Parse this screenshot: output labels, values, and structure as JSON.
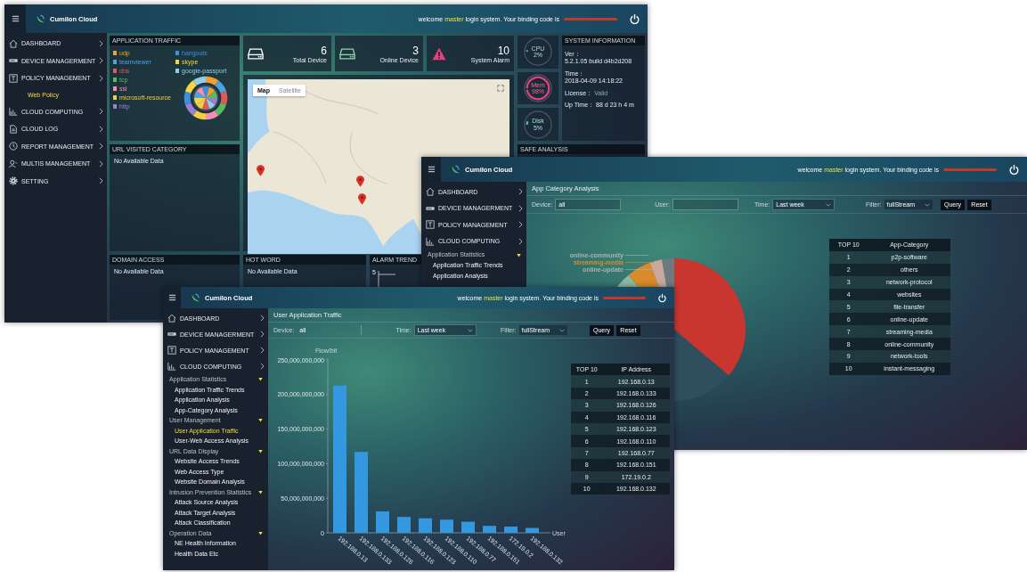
{
  "dashboard_window": {
    "header": {
      "brand": "Cumilon Cloud",
      "greeting": "welcome",
      "user": "master",
      "message": "login system.  Your binding code is"
    },
    "sidebar": {
      "items": [
        {
          "label": "DASHBOARD"
        },
        {
          "label": "DEVICE MANAGERMENT"
        },
        {
          "label": "POLICY MANAGEMENT",
          "children": [
            {
              "label": "Web Policy",
              "selected": true
            }
          ]
        },
        {
          "label": "CLOUD COMPUTING"
        },
        {
          "label": "CLOUD LOG"
        },
        {
          "label": "REPORT MANAGEMENT"
        },
        {
          "label": "MULTIS MANAGEMENT"
        },
        {
          "label": "SETTING"
        }
      ]
    },
    "application_traffic": {
      "title": "APPLICATION TRAFFIC",
      "legend": [
        {
          "label": "udp",
          "color": "#f0a030"
        },
        {
          "label": "teamviewer",
          "color": "#4aa3df"
        },
        {
          "label": "dns",
          "color": "#e05a5a"
        },
        {
          "label": "tcp",
          "color": "#5cb85c"
        },
        {
          "label": "ssl",
          "color": "#f48fb1"
        },
        {
          "label": "microsoft-resource",
          "color": "#f0d040"
        },
        {
          "label": "http",
          "color": "#9b7fd4"
        },
        {
          "label": "hangouts",
          "color": "#3d8fe0"
        },
        {
          "label": "skype",
          "color": "#f5d742"
        },
        {
          "label": "google-passport",
          "color": "#8ecfe8"
        }
      ]
    },
    "stats": [
      {
        "value": "6",
        "label": "Total Device"
      },
      {
        "value": "3",
        "label": "Online Device"
      },
      {
        "value": "10",
        "label": "System Alarm"
      }
    ],
    "gauges": [
      {
        "label": "CPU",
        "value": "2%",
        "level": 0.02
      },
      {
        "label": "Mem",
        "value": "98%",
        "level": 0.98
      },
      {
        "label": "Disk",
        "value": "5%",
        "level": 0.05
      }
    ],
    "system_information": {
      "title": "SYSTEM INFORMATION",
      "rows": [
        {
          "label": "Ver：",
          "value": "5.2.1.05 build d4b2d208"
        },
        {
          "label": "Time：",
          "value": "2018-04-09 14:18:22"
        },
        {
          "label": "License：",
          "value": "Valid"
        },
        {
          "label": "Up Time：",
          "value": "88 d 23 h 4 m"
        }
      ]
    },
    "map": {
      "tabs": [
        {
          "label": "Map",
          "selected": true
        },
        {
          "label": "Satellite",
          "selected": false
        }
      ]
    },
    "url_visited_category": {
      "title": "URL VISITED CATEGORY",
      "message": "No Available Data"
    },
    "safe_analysis": {
      "title": "SAFE ANALYSIS"
    },
    "domain_access": {
      "title": "DOMAIN ACCESS",
      "message": "No Available Data"
    },
    "hot_word": {
      "title": "HOT WORD",
      "message": "No Available Data"
    },
    "alarm_trend": {
      "title": "ALARM TREND",
      "tick": "5"
    }
  },
  "category_window": {
    "header": {
      "brand": "Cumilon Cloud",
      "greeting": "welcome",
      "user": "master",
      "message": "login system.  Your binding code is"
    },
    "sidebar": {
      "items": [
        {
          "label": "DASHBOARD"
        },
        {
          "label": "DEVICE MANAGERMENT"
        },
        {
          "label": "POLICY MANAGEMENT"
        },
        {
          "label": "CLOUD COMPUTING",
          "children": [
            {
              "label": "Application Statistics",
              "expanded": true,
              "children": [
                {
                  "label": "Application Traffic Trends",
                  "selected": false
                },
                {
                  "label": "Application Analysis",
                  "selected": false
                }
              ]
            }
          ]
        }
      ]
    },
    "page_title": "App Category Analysis",
    "filters": [
      {
        "label": "Device:",
        "value": "all",
        "kind": "text"
      },
      {
        "label": "User:",
        "kind": "text"
      },
      {
        "label": "Time:",
        "value": "Last week",
        "kind": "select"
      },
      {
        "label": "Filter:",
        "value": "fullStream",
        "kind": "select"
      }
    ],
    "buttons": [
      "Query",
      "Reset"
    ],
    "slice_labels": [
      {
        "label": "online-community",
        "color": "#a9b3b0"
      },
      {
        "label": "streaming-media",
        "color": "#d98a2a"
      },
      {
        "label": "online-update",
        "color": "#a9b3b0"
      }
    ],
    "table": {
      "columns": [
        "TOP 10",
        "App-Category"
      ],
      "rows": [
        [
          "1",
          "p2p-software"
        ],
        [
          "2",
          "others"
        ],
        [
          "3",
          "network-protocol"
        ],
        [
          "4",
          "websites"
        ],
        [
          "5",
          "file-transfer"
        ],
        [
          "6",
          "online-update"
        ],
        [
          "7",
          "streaming-media"
        ],
        [
          "8",
          "online-community"
        ],
        [
          "9",
          "network-tools"
        ],
        [
          "10",
          "instant-messaging"
        ]
      ]
    }
  },
  "traffic_window": {
    "header": {
      "brand": "Cumilon Cloud",
      "greeting": "welcome",
      "user": "master",
      "message": "login system.  Your binding code is"
    },
    "sidebar": {
      "items": [
        {
          "label": "DASHBOARD"
        },
        {
          "label": "DEVICE MANAGERMENT"
        },
        {
          "label": "POLICY MANAGEMENT"
        },
        {
          "label": "CLOUD COMPUTING",
          "children": [
            {
              "label": "Application Statistics",
              "expanded": true,
              "children": [
                {
                  "label": "Application Traffic Trends",
                  "selected": false
                },
                {
                  "label": "Application Analysis",
                  "selected": false
                },
                {
                  "label": "App-Category Analysis",
                  "selected": false
                }
              ]
            },
            {
              "label": "User Management",
              "expanded": true,
              "children": [
                {
                  "label": "User Application Traffic",
                  "selected": true
                },
                {
                  "label": "User-Web Access Analysis",
                  "selected": false
                }
              ]
            },
            {
              "label": "URL Data Display",
              "expanded": true,
              "children": [
                {
                  "label": "Website Access Trends",
                  "selected": false
                },
                {
                  "label": "Web Access Type",
                  "selected": false
                },
                {
                  "label": "Website Domain Analysis",
                  "selected": false
                }
              ]
            },
            {
              "label": "Intrusion Prevention Statistics",
              "expanded": true,
              "children": [
                {
                  "label": "Attack Source Analysis",
                  "selected": false
                },
                {
                  "label": "Attack Target Analysis",
                  "selected": false
                },
                {
                  "label": "Attack Classification",
                  "selected": false
                }
              ]
            },
            {
              "label": "Operation Data",
              "expanded": true,
              "children": [
                {
                  "label": "NE Health Information",
                  "selected": false
                },
                {
                  "label": "Health Data Etc",
                  "selected": false
                }
              ]
            }
          ]
        }
      ]
    },
    "page_title": "User Application Traffic",
    "filters": [
      {
        "label": "Device:",
        "value": "all",
        "kind": "text"
      },
      {
        "label": "Time:",
        "value": "Last week",
        "kind": "select"
      },
      {
        "label": "Filter:",
        "value": "fullStream",
        "kind": "select"
      }
    ],
    "buttons": [
      "Query",
      "Reset"
    ],
    "chart_data": {
      "type": "bar",
      "ylabel": "Flow/bit",
      "xlabel": "User",
      "categories": [
        "192.168.0.13",
        "192.168.0.133",
        "192.168.0.126",
        "192.168.0.116",
        "192.168.0.123",
        "192.168.0.110",
        "192.168.0.77",
        "192.168.0.151",
        "172.19.0.2",
        "192.168.0.132"
      ],
      "values": [
        213000000000,
        117000000000,
        31000000000,
        23000000000,
        21000000000,
        19000000000,
        16000000000,
        10000000000,
        9000000000,
        7000000000
      ],
      "ylim": [
        0,
        250000000000
      ],
      "yticks": [
        {
          "value": 0,
          "label": "0"
        },
        {
          "value": 50000000000,
          "label": "50,000,000,000"
        },
        {
          "value": 100000000000,
          "label": "100,000,000,000"
        },
        {
          "value": 150000000000,
          "label": "150,000,000,000"
        },
        {
          "value": 200000000000,
          "label": "200,000,000,000"
        },
        {
          "value": 250000000000,
          "label": "250,000,000,000"
        }
      ]
    },
    "table": {
      "columns": [
        "TOP 10",
        "IP Address"
      ],
      "rows": [
        [
          "1",
          "192.168.0.13"
        ],
        [
          "2",
          "192.168.0.133"
        ],
        [
          "3",
          "192.168.0.126"
        ],
        [
          "4",
          "192.168.0.116"
        ],
        [
          "5",
          "192.168.0.123"
        ],
        [
          "6",
          "192.168.0.110"
        ],
        [
          "7",
          "192.168.0.77"
        ],
        [
          "8",
          "192.168.0.151"
        ],
        [
          "9",
          "172.19.0.2"
        ],
        [
          "10",
          "192.168.0.132"
        ]
      ]
    }
  }
}
